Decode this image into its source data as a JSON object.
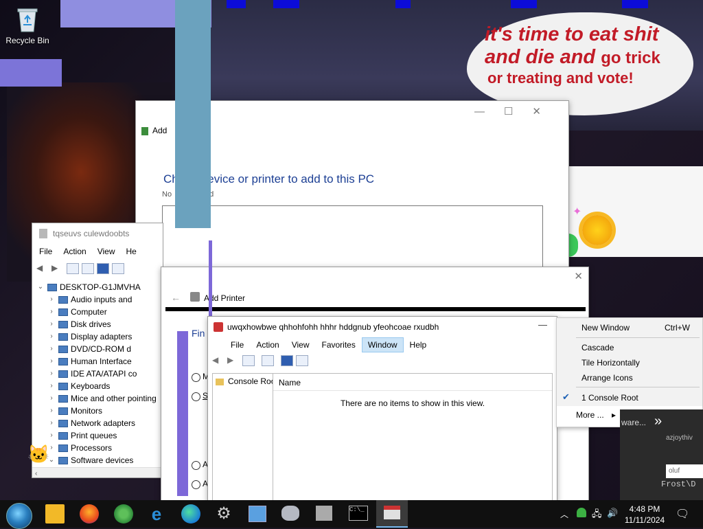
{
  "desktop": {
    "recycle_bin_label": "Recycle Bin",
    "speech_line1": "it's time to eat shit",
    "speech_line2a": "and die and ",
    "speech_line2b": "go trick",
    "speech_line3": "or treating and vote!"
  },
  "add_device": {
    "title": "Add",
    "heading": "Ch       device or printer to add to this PC",
    "subtext": "No              und"
  },
  "device_manager": {
    "title": "tqseuvs  culewdoobts",
    "menu": [
      "File",
      "Action",
      "View",
      "He"
    ],
    "tree": [
      {
        "label": "DESKTOP-G1JMVHA",
        "chev": "⌄",
        "root": true
      },
      {
        "label": "Audio inputs and",
        "chev": "›"
      },
      {
        "label": "Computer",
        "chev": "›"
      },
      {
        "label": "Disk drives",
        "chev": "›"
      },
      {
        "label": "Display adapters",
        "chev": "›"
      },
      {
        "label": "DVD/CD-ROM d",
        "chev": "›"
      },
      {
        "label": "Human Interface",
        "chev": "›"
      },
      {
        "label": "IDE ATA/ATAPI co",
        "chev": "›"
      },
      {
        "label": "Keyboards",
        "chev": "›"
      },
      {
        "label": "Mice and other pointing",
        "chev": "›"
      },
      {
        "label": "Monitors",
        "chev": "›"
      },
      {
        "label": "Network adapters",
        "chev": "›"
      },
      {
        "label": "Print queues",
        "chev": "›"
      },
      {
        "label": "Processors",
        "chev": "›"
      },
      {
        "label": "Software devices",
        "chev": "⌄"
      }
    ]
  },
  "add_printer": {
    "title": "Add Printer",
    "find_heading": "Fin",
    "radio_labels": [
      "M",
      "S",
      "A",
      "A"
    ]
  },
  "mmc": {
    "title": "uwqxhowbwe qhhohfohh hhhr hddgnub yfeohcoae rxudbh",
    "minimize": "—",
    "menu": [
      "File",
      "Action",
      "View",
      "Favorites",
      "Window",
      "Help"
    ],
    "active_menu": "Window",
    "tree_root": "Console Roo",
    "column_name": "Name",
    "empty_text": "There are no items to show in this view."
  },
  "context_menu": {
    "new_window": "New Window",
    "new_window_shortcut": "Ctrl+W",
    "cascade": "Cascade",
    "tile_horizontally": "Tile Horizontally",
    "arrange_icons": "Arrange Icons",
    "console_root": "1 Console Root",
    "more": "More ...",
    "more_arrow": "▸"
  },
  "background_fragments": {
    "ware": "ware...",
    "chevrons": "»",
    "azjoy": "azjoythiv",
    "oluf": "oluf",
    "frost": "Frost\\D"
  },
  "taskbar": {
    "time": "4:48 PM",
    "date": "11/11/2024"
  }
}
